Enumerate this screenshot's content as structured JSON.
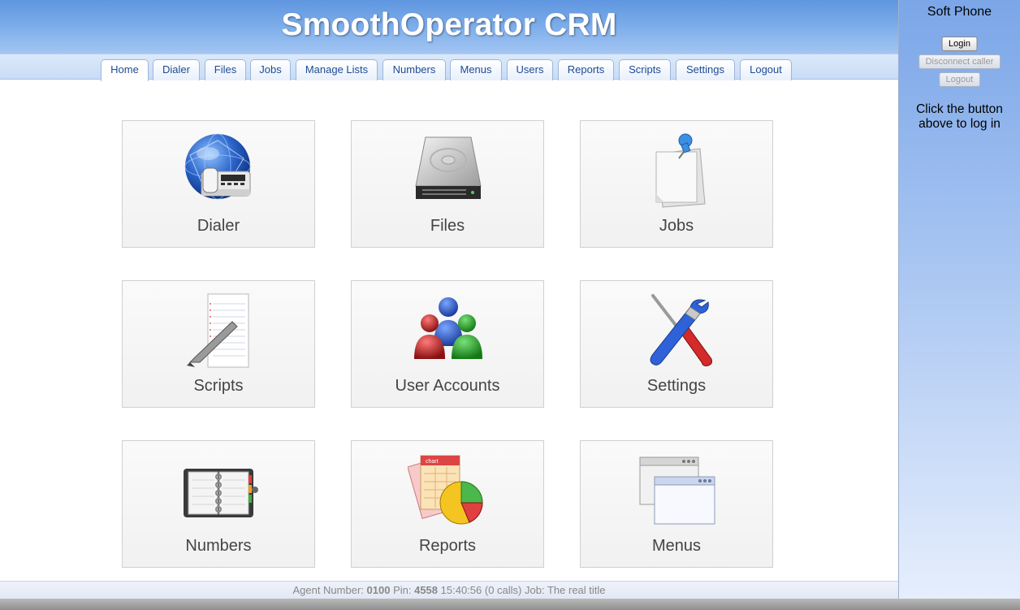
{
  "header": {
    "title": "SmoothOperator CRM"
  },
  "tabs": [
    {
      "label": "Home",
      "active": true
    },
    {
      "label": "Dialer"
    },
    {
      "label": "Files"
    },
    {
      "label": "Jobs"
    },
    {
      "label": "Manage Lists"
    },
    {
      "label": "Numbers"
    },
    {
      "label": "Menus"
    },
    {
      "label": "Users"
    },
    {
      "label": "Reports"
    },
    {
      "label": "Scripts"
    },
    {
      "label": "Settings"
    },
    {
      "label": "Logout"
    }
  ],
  "cards": [
    {
      "label": "Dialer",
      "icon": "globe-phone-icon"
    },
    {
      "label": "Files",
      "icon": "hard-drive-icon"
    },
    {
      "label": "Jobs",
      "icon": "pinned-notes-icon"
    },
    {
      "label": "Scripts",
      "icon": "notepad-pen-icon"
    },
    {
      "label": "User Accounts",
      "icon": "users-group-icon"
    },
    {
      "label": "Settings",
      "icon": "screwdriver-wrench-icon"
    },
    {
      "label": "Numbers",
      "icon": "address-book-icon"
    },
    {
      "label": "Reports",
      "icon": "chart-report-icon"
    },
    {
      "label": "Menus",
      "icon": "windows-icon"
    }
  ],
  "chart_icon_text": "chart",
  "status": {
    "agent_label": "Agent Number:",
    "agent_number": "0100",
    "pin_label": "Pin:",
    "pin": "4558",
    "time": "15:40:56",
    "calls": "(0 calls)",
    "job_label": "Job:",
    "job": "The real title"
  },
  "softphone": {
    "title": "Soft Phone",
    "login_label": "Login",
    "disconnect_label": "Disconnect caller",
    "logout_label": "Logout",
    "message_line1": "Click the button",
    "message_line2": "above to log in"
  },
  "colors": {
    "header_top": "#5f96e0",
    "header_bottom": "#a3c6f3",
    "tab_text": "#1f4b94"
  }
}
